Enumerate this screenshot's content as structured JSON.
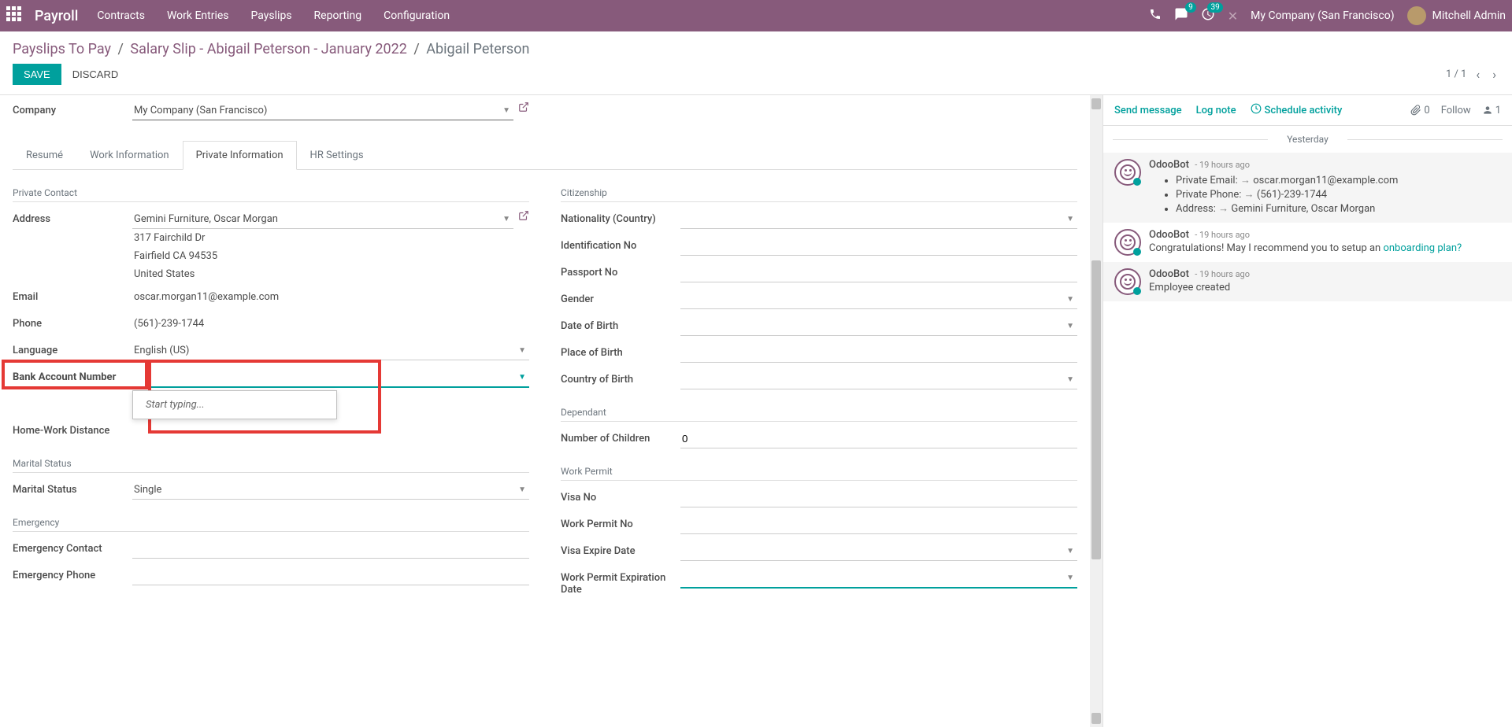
{
  "nav": {
    "brand": "Payroll",
    "menu": [
      "Contracts",
      "Work Entries",
      "Payslips",
      "Reporting",
      "Configuration"
    ],
    "msg_badge": "9",
    "activity_badge": "39",
    "company": "My Company (San Francisco)",
    "user": "Mitchell Admin"
  },
  "breadcrumb": {
    "root": "Payslips To Pay",
    "mid": "Salary Slip - Abigail Peterson - January 2022",
    "current": "Abigail Peterson"
  },
  "actions": {
    "save": "SAVE",
    "discard": "DISCARD",
    "pager": "1 / 1"
  },
  "tabs": [
    "Resumé",
    "Work Information",
    "Private Information",
    "HR Settings"
  ],
  "form": {
    "company_label": "Company",
    "company_value": "My Company (San Francisco)",
    "left": {
      "section_contact": "Private Contact",
      "address_label": "Address",
      "address_value": "Gemini Furniture, Oscar Morgan",
      "address_line1": "317 Fairchild Dr",
      "address_line2": "Fairfield CA 94535",
      "address_line3": "United States",
      "email_label": "Email",
      "email_value": "oscar.morgan11@example.com",
      "phone_label": "Phone",
      "phone_value": "(561)-239-1744",
      "lang_label": "Language",
      "lang_value": "English (US)",
      "bank_label": "Bank Account Number",
      "dist_label": "Home-Work Distance",
      "section_marital": "Marital Status",
      "marital_label": "Marital Status",
      "marital_value": "Single",
      "section_emergency": "Emergency",
      "em_contact_label": "Emergency Contact",
      "em_phone_label": "Emergency Phone"
    },
    "right": {
      "section_citizen": "Citizenship",
      "nationality_label": "Nationality (Country)",
      "idno_label": "Identification No",
      "passport_label": "Passport No",
      "gender_label": "Gender",
      "dob_label": "Date of Birth",
      "pob_label": "Place of Birth",
      "cob_label": "Country of Birth",
      "section_dependant": "Dependant",
      "children_label": "Number of Children",
      "children_value": "0",
      "section_permit": "Work Permit",
      "visa_label": "Visa No",
      "permit_label": "Work Permit No",
      "visa_exp_label": "Visa Expire Date",
      "permit_exp_label": "Work Permit Expiration Date"
    },
    "dropdown_placeholder": "Start typing..."
  },
  "chatter": {
    "send": "Send message",
    "log": "Log note",
    "schedule": "Schedule activity",
    "attach_count": "0",
    "follow": "Follow",
    "follower_count": "1",
    "date_sep": "Yesterday",
    "messages": [
      {
        "author": "OdooBot",
        "time": "- 19 hours ago",
        "bg": true,
        "items": [
          {
            "label": "Private Email:",
            "value": "oscar.morgan11@example.com"
          },
          {
            "label": "Private Phone:",
            "value": "(561)-239-1744"
          },
          {
            "label": "Address:",
            "value": "Gemini Furniture, Oscar Morgan"
          }
        ]
      },
      {
        "author": "OdooBot",
        "time": "- 19 hours ago",
        "bg": false,
        "html": "Congratulations! May I recommend you to setup an <a>onboarding plan?</a>"
      },
      {
        "author": "OdooBot",
        "time": "- 19 hours ago",
        "bg": true,
        "text": "Employee created"
      }
    ]
  }
}
